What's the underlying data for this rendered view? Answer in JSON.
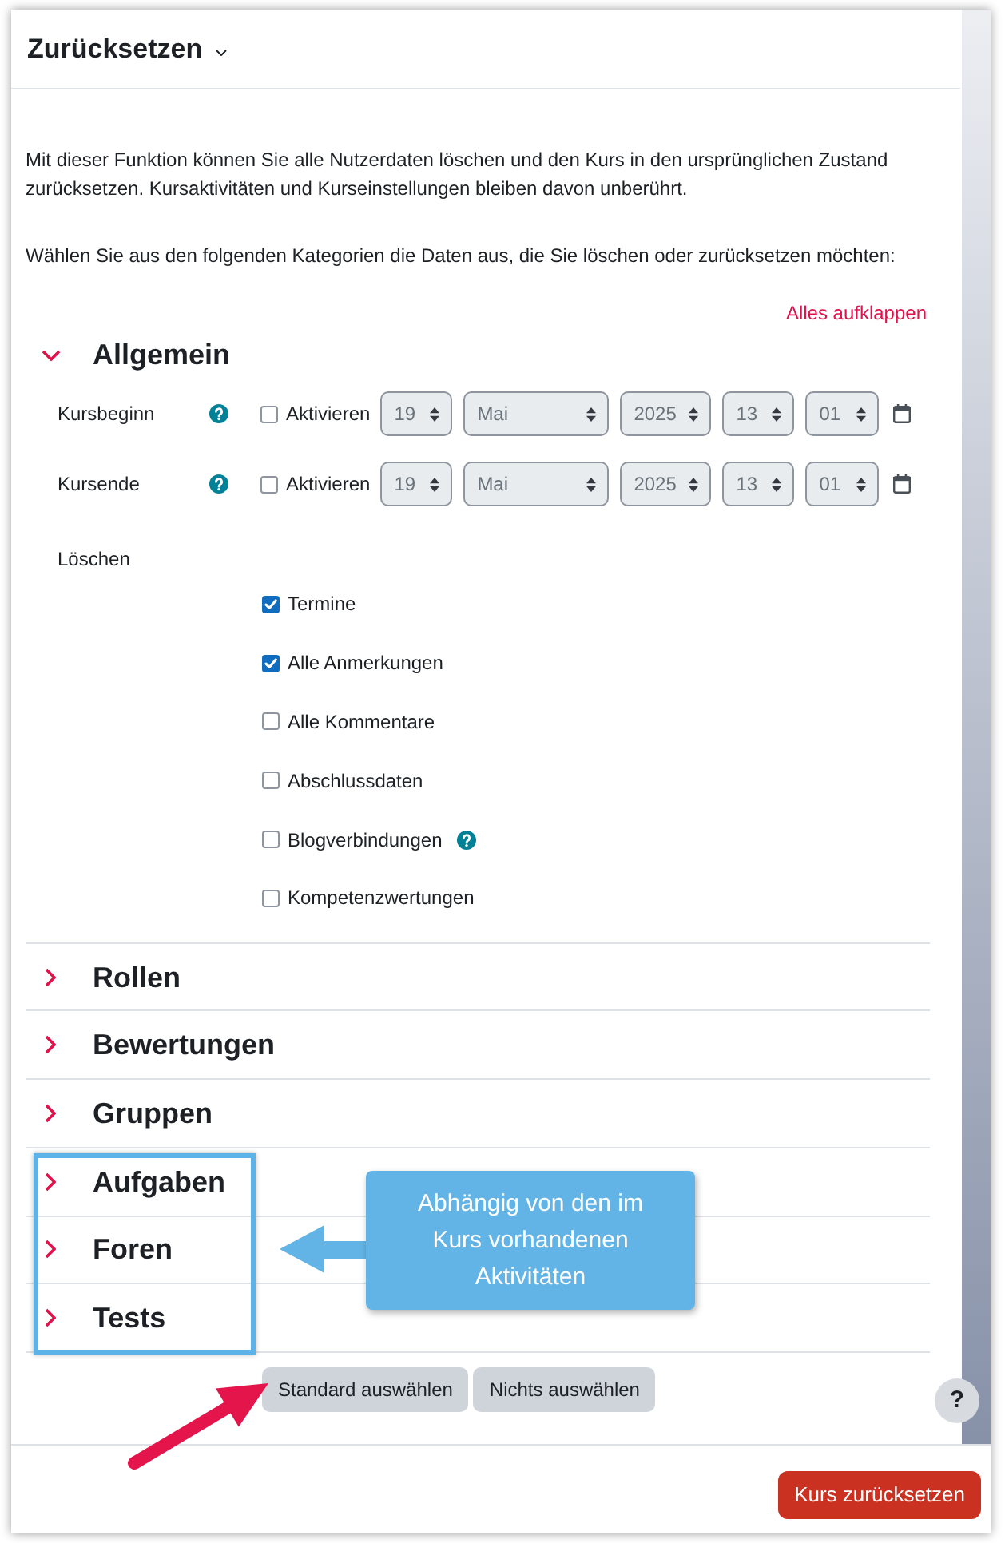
{
  "dialog": {
    "title": "Zurücksetzen"
  },
  "intro": [
    "Mit dieser Funktion können Sie alle Nutzerdaten löschen und den Kurs in den ursprünglichen Zustand zurücksetzen. Kursaktivitäten und Kurseinstellungen bleiben davon unberührt.",
    "Wählen Sie aus den folgenden Kategorien die Daten aus, die Sie löschen oder zurücksetzen möchten:"
  ],
  "expand_all_link": "Alles aufklappen",
  "sections": [
    {
      "title": "Allgemein",
      "expanded": true,
      "highlighted": false,
      "date_fields": [
        {
          "label": "Kursbeginn",
          "help": true,
          "checkbox": {
            "label": "Aktivieren",
            "checked": false
          },
          "selects": [
            "19",
            "Mai",
            "2025",
            "13",
            "01"
          ]
        },
        {
          "label": "Kursende",
          "help": true,
          "checkbox": {
            "label": "Aktivieren",
            "checked": false
          },
          "selects": [
            "19",
            "Mai",
            "2025",
            "13",
            "01"
          ]
        }
      ],
      "delete_group": {
        "label": "Löschen",
        "options": [
          {
            "label": "Termine",
            "checked": true,
            "help": false
          },
          {
            "label": "Alle Anmerkungen",
            "checked": true,
            "help": false
          },
          {
            "label": "Alle Kommentare",
            "checked": false,
            "help": false
          },
          {
            "label": "Abschlussdaten",
            "checked": false,
            "help": false
          },
          {
            "label": "Blogverbindungen",
            "checked": false,
            "help": true
          },
          {
            "label": "Kompetenzwertungen",
            "checked": false,
            "help": false
          }
        ]
      }
    },
    {
      "title": "Rollen",
      "expanded": false,
      "highlighted": false
    },
    {
      "title": "Bewertungen",
      "expanded": false,
      "highlighted": false
    },
    {
      "title": "Gruppen",
      "expanded": false,
      "highlighted": false
    },
    {
      "title": "Aufgaben",
      "expanded": false,
      "highlighted": true
    },
    {
      "title": "Foren",
      "expanded": false,
      "highlighted": true
    },
    {
      "title": "Tests",
      "expanded": false,
      "highlighted": true
    }
  ],
  "select_buttons": [
    "Standard auswählen",
    "Nichts auswählen"
  ],
  "annotations": {
    "callout": "Abhängig von den im Kurs vorhandenen Aktivitäten"
  },
  "help_button": "?",
  "footer": {
    "submit_button": "Kurs zurücksetzen"
  }
}
